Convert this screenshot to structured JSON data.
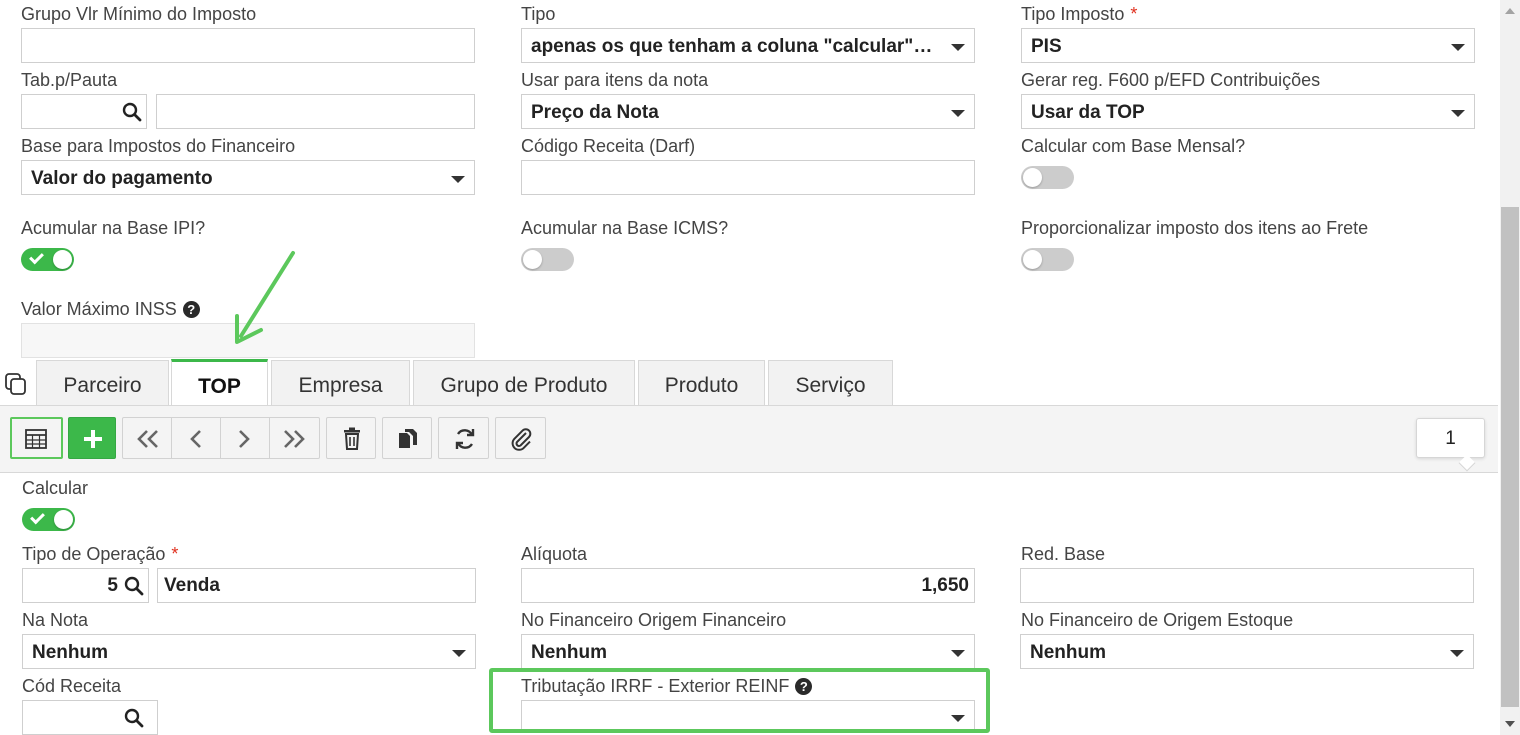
{
  "form": {
    "grupo_vlr_minimo_label": "Grupo Vlr Mínimo do Imposto",
    "tipo_label": "Tipo",
    "tipo_value": "apenas os que tenham a coluna \"calcular\" marcada",
    "tipo_imposto_label": "Tipo Imposto",
    "tipo_imposto_value": "PIS",
    "tab_pauta_label": "Tab.p/Pauta",
    "usar_itens_label": "Usar para itens da nota",
    "usar_itens_value": "Preço da Nota",
    "gerar_f600_label": "Gerar reg. F600 p/EFD Contribuições",
    "gerar_f600_value": "Usar da TOP",
    "base_financeiro_label": "Base para Impostos do Financeiro",
    "base_financeiro_value": "Valor do pagamento",
    "codigo_receita_darf_label": "Código Receita (Darf)",
    "calcular_base_mensal_label": "Calcular com Base Mensal?",
    "acumular_ipi_label": "Acumular na Base IPI?",
    "acumular_icms_label": "Acumular na Base ICMS?",
    "proporcionalizar_label": "Proporcionalizar imposto dos itens ao Frete",
    "valor_maximo_inss_label": "Valor Máximo INSS",
    "required_mark": "*",
    "help_mark": "?"
  },
  "tabs": [
    "Parceiro",
    "TOP",
    "Empresa",
    "Grupo de Produto",
    "Produto",
    "Serviço"
  ],
  "toolbar": {
    "record_count": "1"
  },
  "detail": {
    "calcular_label": "Calcular",
    "tipo_operacao_label": "Tipo de Operação",
    "tipo_operacao_code": "5",
    "tipo_operacao_desc": "Venda",
    "aliquota_label": "Alíquota",
    "aliquota_value": "1,650",
    "red_base_label": "Red. Base",
    "na_nota_label": "Na Nota",
    "na_nota_value": "Nenhum",
    "fin_origem_fin_label": "No Financeiro Origem Financeiro",
    "fin_origem_fin_value": "Nenhum",
    "fin_origem_est_label": "No Financeiro de Origem Estoque",
    "fin_origem_est_value": "Nenhum",
    "cod_receita_label": "Cód Receita",
    "tributacao_irrf_label": "Tributação IRRF - Exterior REINF"
  },
  "colors": {
    "accent": "#3cb84a",
    "highlight": "#5cc85c",
    "required": "#e0301e"
  }
}
